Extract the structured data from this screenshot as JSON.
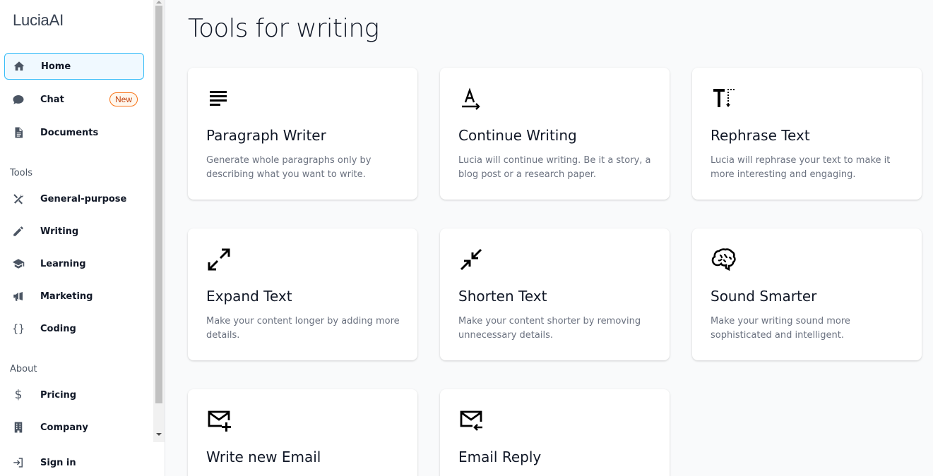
{
  "brand": "LuciaAI",
  "nav": {
    "home": "Home",
    "chat": "Chat",
    "chat_badge": "New",
    "documents": "Documents"
  },
  "sections": {
    "tools": "Tools",
    "about": "About"
  },
  "tools": {
    "general": "General-purpose",
    "writing": "Writing",
    "learning": "Learning",
    "marketing": "Marketing",
    "coding": "Coding"
  },
  "about": {
    "pricing": "Pricing",
    "company": "Company"
  },
  "signin": "Sign in",
  "main": {
    "title": "Tools for writing",
    "cards": [
      {
        "title": "Paragraph Writer",
        "desc": "Generate whole paragraphs only by describing what you want to write.",
        "icon": "paragraph-icon"
      },
      {
        "title": "Continue Writing",
        "desc": "Lucia will continue writing. Be it a story, a blog post or a research paper.",
        "icon": "text-continue-icon"
      },
      {
        "title": "Rephrase Text",
        "desc": "Lucia will rephrase your text to make it more interesting and engaging.",
        "icon": "text-rotate-icon"
      },
      {
        "title": "Expand Text",
        "desc": "Make your content longer by adding more details.",
        "icon": "expand-arrows-icon"
      },
      {
        "title": "Shorten Text",
        "desc": "Make your content shorter by removing unnecessary details.",
        "icon": "collapse-arrows-icon"
      },
      {
        "title": "Sound Smarter",
        "desc": "Make your writing sound more sophisticated and intelligent.",
        "icon": "brain-icon"
      },
      {
        "title": "Write new Email",
        "desc": "",
        "icon": "email-plus-icon"
      },
      {
        "title": "Email Reply",
        "desc": "",
        "icon": "email-reply-icon"
      }
    ]
  }
}
